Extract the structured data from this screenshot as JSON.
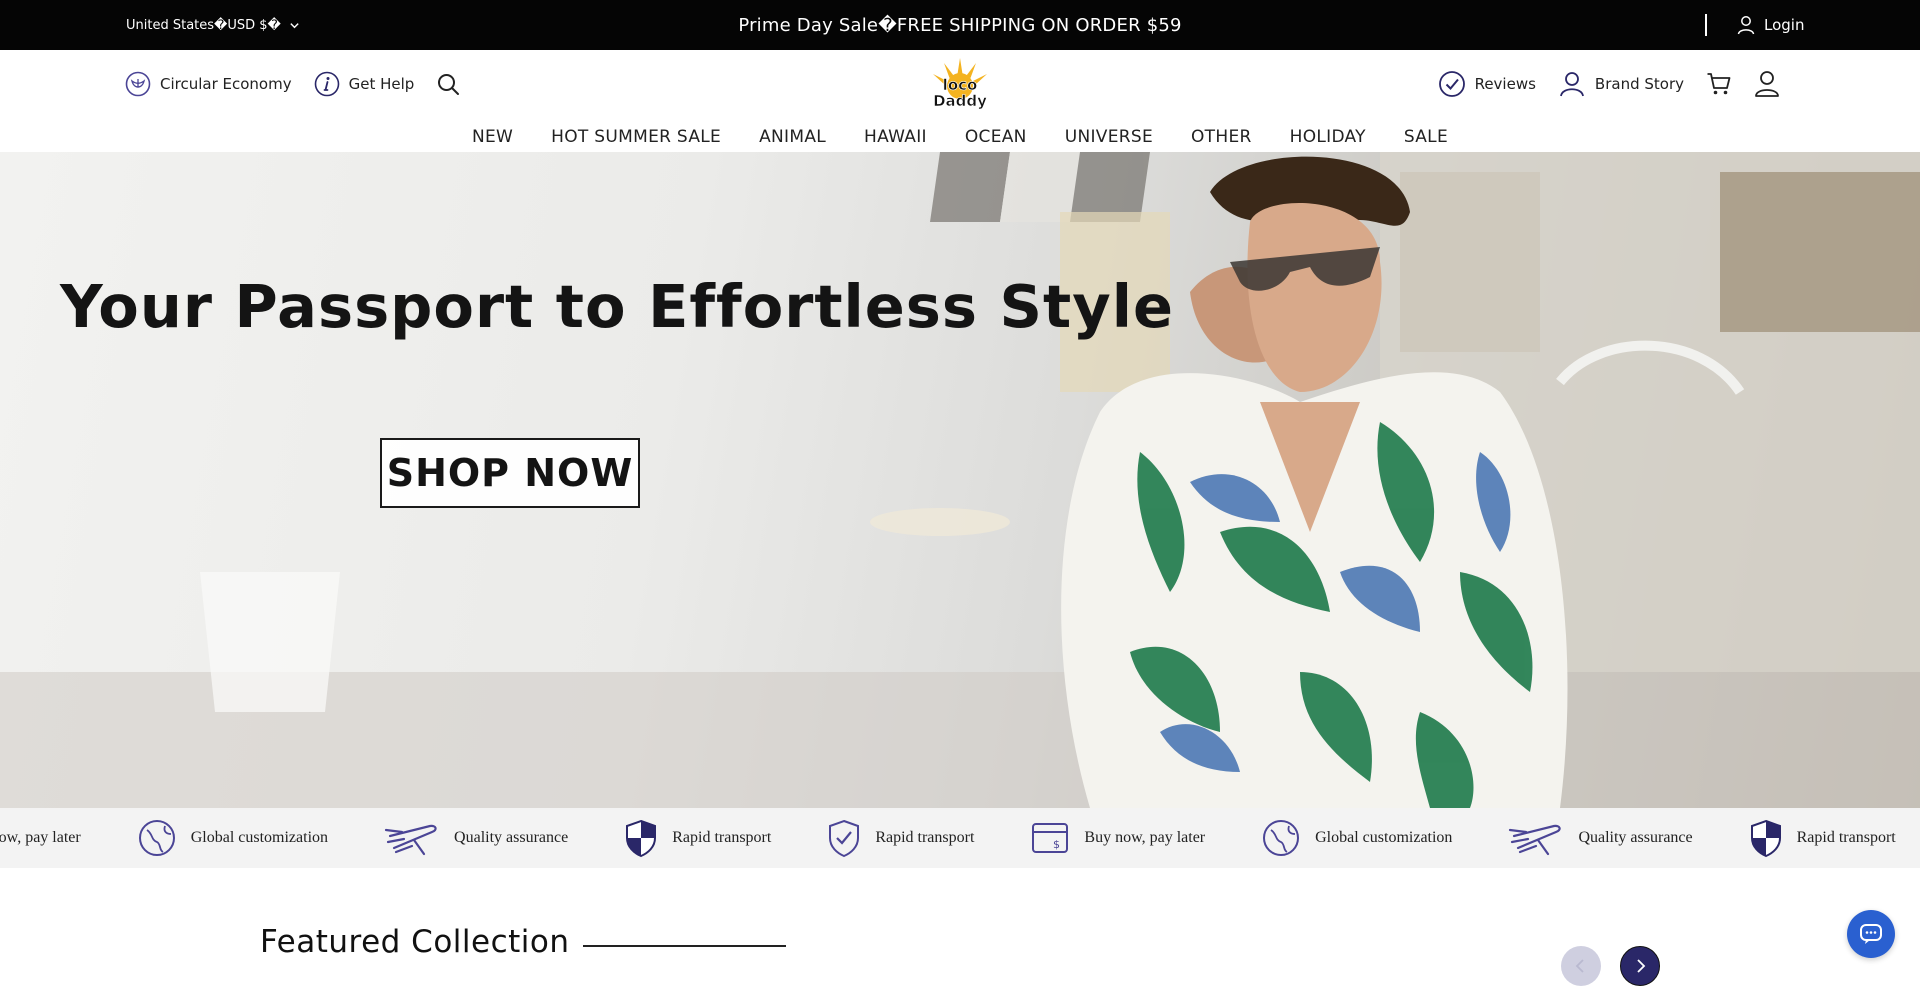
{
  "topbar": {
    "region_label": "United States�USD $�",
    "announcement": "Prime Day Sale�FREE SHIPPING ON ORDER $59",
    "login_label": "Login"
  },
  "header": {
    "left_links": [
      {
        "label": "Circular Economy",
        "icon": "leaf-circle-icon"
      },
      {
        "label": "Get Help",
        "icon": "info-icon"
      }
    ],
    "logo_text": "loco Daddy",
    "right_links": [
      {
        "label": "Reviews",
        "icon": "check-circle-icon"
      },
      {
        "label": "Brand Story",
        "icon": "user-icon"
      }
    ]
  },
  "nav": {
    "items": [
      "NEW",
      "HOT SUMMER SALE",
      "ANIMAL",
      "HAWAII",
      "OCEAN",
      "UNIVERSE",
      "OTHER",
      "HOLIDAY",
      "SALE"
    ]
  },
  "hero": {
    "title": "Your Passport to Effortless Style",
    "cta_label": "SHOP NOW"
  },
  "features": {
    "items": [
      {
        "label": "Buy now, pay later",
        "icon": "card-icon"
      },
      {
        "label": "Global customization",
        "icon": "globe-icon"
      },
      {
        "label": "Quality assurance",
        "icon": "plane-icon"
      },
      {
        "label": "Rapid transport",
        "icon": "shield-icon"
      },
      {
        "label": "Rapid transport",
        "icon": "shield-check-icon"
      },
      {
        "label": "Buy now, pay later",
        "icon": "card-icon"
      },
      {
        "label": "Global customization",
        "icon": "globe-icon"
      },
      {
        "label": "Quality assurance",
        "icon": "plane-icon"
      },
      {
        "label": "Rapid transport",
        "icon": "shield-icon"
      }
    ]
  },
  "featured": {
    "title": "Featured Collection"
  },
  "colors": {
    "topbar_bg": "#050505",
    "accent_navy": "#2a2768",
    "icon_purple": "#4b4596",
    "chat_blue": "#2a60d0"
  }
}
